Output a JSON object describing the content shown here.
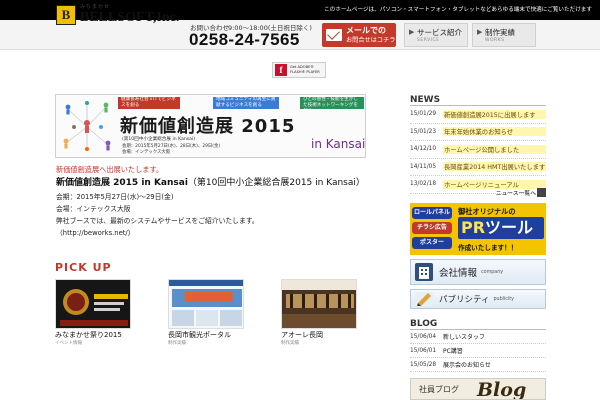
{
  "topbar": {
    "text": "このホームページは、パソコン・スマートフォン・タブレットなどあらゆる端末で快適にご覧いただけます"
  },
  "header": {
    "logo_kana": "みなまかせ",
    "logo_name": "BELLSOFT,Inc.",
    "contact_label": "お問い合わせ",
    "contact_hours": "9:00〜18:00(土日祝日除く)",
    "phone": "0258-24-7565",
    "mail_line1": "メールでの",
    "mail_line2": "お問合せはコチラ",
    "nav": [
      {
        "label": "サービス紹介",
        "sub": "SERVICE"
      },
      {
        "label": "制作実績",
        "sub": "WORKS"
      }
    ]
  },
  "flash": {
    "line1": "Get ADOBE®",
    "line2": "FLASH® PLAYER"
  },
  "banner": {
    "tags": [
      "健康長寿社会ｘITでビジネスを創る",
      "地域コミュニティの再生に貢献するビジネスを創る",
      "ひとの感性・技能を生かした技術ネットワーキングを創る"
    ],
    "title": "新価値創造展 2015",
    "subtitle": "(第10回中小企業総合展 in Kansai)",
    "date": "会期：2015年5月27日(水)、28日(木)、29日(金)",
    "venue": "会場：インテックス大阪",
    "in_kansai": "in Kansai"
  },
  "article": {
    "red_link": "新価値創造展へ出展いたします。",
    "title_bold": "新価値創造展 2015 in Kansai",
    "title_rest": "（第10回中小企業総合展2015 in Kansai）",
    "lines": [
      "会期：2015年5月27日(水)〜29日(金)",
      "会場：インテックス大阪",
      "弊社ブースでは、最新のシステムやサービスをご紹介いたします。",
      "（http://beworks.net/）"
    ]
  },
  "pickup": {
    "heading": "PICK UP",
    "items": [
      {
        "caption": "みなまかせ祭り2015",
        "sub": "イベント情報"
      },
      {
        "caption": "長岡市観光ポータル",
        "sub": "制作実績"
      },
      {
        "caption": "アオーレ長岡",
        "sub": "制作実績"
      }
    ]
  },
  "news": {
    "heading": "NEWS",
    "items": [
      {
        "date": "15/01/29",
        "title": "新価値創造展2015に出展します",
        "highlight": true
      },
      {
        "date": "15/01/23",
        "title": "年末年始休業のお知らせ",
        "highlight": true
      },
      {
        "date": "14/12/10",
        "title": "ホームページ公開しました",
        "highlight": true
      },
      {
        "date": "14/11/05",
        "title": "長岡産業2014 HMT出展いたします",
        "highlight": true
      },
      {
        "date": "13/02/18",
        "title": "ホームページリニューアル",
        "highlight": true
      }
    ],
    "more": "ニュース一覧へ"
  },
  "ad": {
    "tags": [
      "ロールパネル",
      "チラシ広告",
      "ポスター"
    ],
    "tag_colors": [
      "#1f3f9e",
      "#c0392b",
      "#1f3f9e"
    ],
    "head": "御社オリジナルの",
    "big_pr": "PR",
    "big_rest": "ツール",
    "sub": "作成いたします！！"
  },
  "side_buttons": [
    {
      "label": "会社情報",
      "sub": "company",
      "icon": "building-icon"
    },
    {
      "label": "パブリシティ",
      "sub": "publicity",
      "icon": "pencil-icon"
    }
  ],
  "blog": {
    "heading": "BLOG",
    "items": [
      {
        "date": "15/06/04",
        "title": "新しいスタッフ"
      },
      {
        "date": "15/06/01",
        "title": "PC講習"
      },
      {
        "date": "15/05/28",
        "title": "展示会のお知らせ"
      }
    ],
    "banner_jp": "社員ブログ",
    "banner_en": "Blog"
  }
}
